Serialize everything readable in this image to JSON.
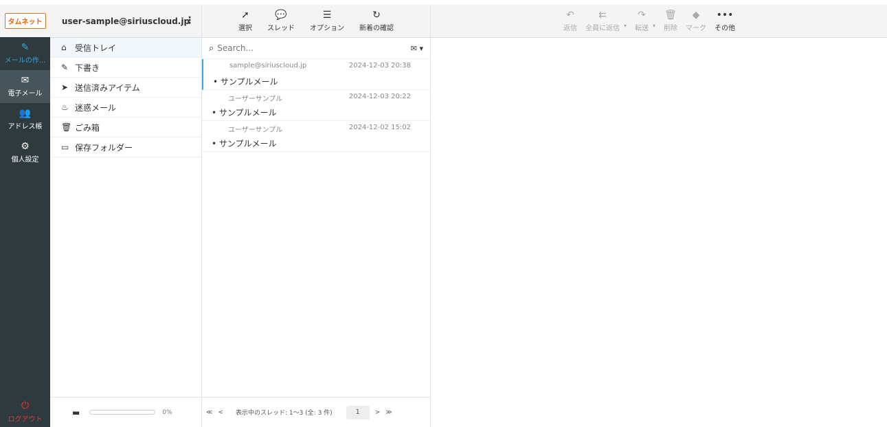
{
  "logo": "タムネット",
  "nav": {
    "items": [
      {
        "label": "メールの作...",
        "icon": "compose-icon",
        "glyph": "✎"
      },
      {
        "label": "電子メール",
        "icon": "envelope-icon",
        "glyph": "✉"
      },
      {
        "label": "アドレス帳",
        "icon": "contacts-icon",
        "glyph": "👥"
      },
      {
        "label": "個人設定",
        "icon": "gear-icon",
        "glyph": "⚙"
      }
    ],
    "logout": "ログアウト"
  },
  "account": "user-sample@siriuscloud.jp",
  "folders": [
    {
      "label": "受信トレイ",
      "icon": "inbox-icon",
      "glyph": "⌂"
    },
    {
      "label": "下書き",
      "icon": "pencil-icon",
      "glyph": "✎"
    },
    {
      "label": "送信済みアイテム",
      "icon": "paper-plane-icon",
      "glyph": "➤"
    },
    {
      "label": "迷惑メール",
      "icon": "fire-icon",
      "glyph": "♨"
    },
    {
      "label": "ごみ箱",
      "icon": "trash-icon",
      "glyph": "🗑"
    },
    {
      "label": "保存フォルダー",
      "icon": "folder-icon",
      "glyph": "▭"
    }
  ],
  "quota": "0%",
  "list_toolbar": [
    {
      "label": "選択",
      "icon": "pointer-icon",
      "glyph": "➚"
    },
    {
      "label": "スレッド",
      "icon": "threads-icon",
      "glyph": "💬"
    },
    {
      "label": "オプション",
      "icon": "options-icon",
      "glyph": "☰"
    },
    {
      "label": "新着の確認",
      "icon": "refresh-icon",
      "glyph": "↻"
    }
  ],
  "search": {
    "placeholder": "Search..."
  },
  "messages": [
    {
      "from": "sample@siriuscloud.jp",
      "date": "2024-12-03 20:38",
      "subject": "• サンプルメール"
    },
    {
      "from": "ユーザーサンプル",
      "date": "2024-12-03 20:22",
      "subject": "• サンプルメール"
    },
    {
      "from": "ユーザーサンプル",
      "date": "2024-12-02 15:02",
      "subject": "• サンプルメール"
    }
  ],
  "pagination": {
    "first": "≪",
    "prev": "<",
    "status": "表示中のスレッド: 1～3 (全: 3 件)",
    "page": "1",
    "next": ">",
    "last": "≫"
  },
  "reading_toolbar": [
    {
      "label": "返信",
      "icon": "reply-icon",
      "glyph": "↶"
    },
    {
      "label": "全員に返信",
      "icon": "reply-all-icon",
      "glyph": "⇇"
    },
    {
      "label": "転送",
      "icon": "forward-icon",
      "glyph": "↷"
    },
    {
      "label": "削除",
      "icon": "trash-icon",
      "glyph": "🗑"
    },
    {
      "label": "マーク",
      "icon": "tag-icon",
      "glyph": "◆"
    },
    {
      "label": "その他",
      "icon": "more-icon",
      "glyph": "•••"
    }
  ]
}
